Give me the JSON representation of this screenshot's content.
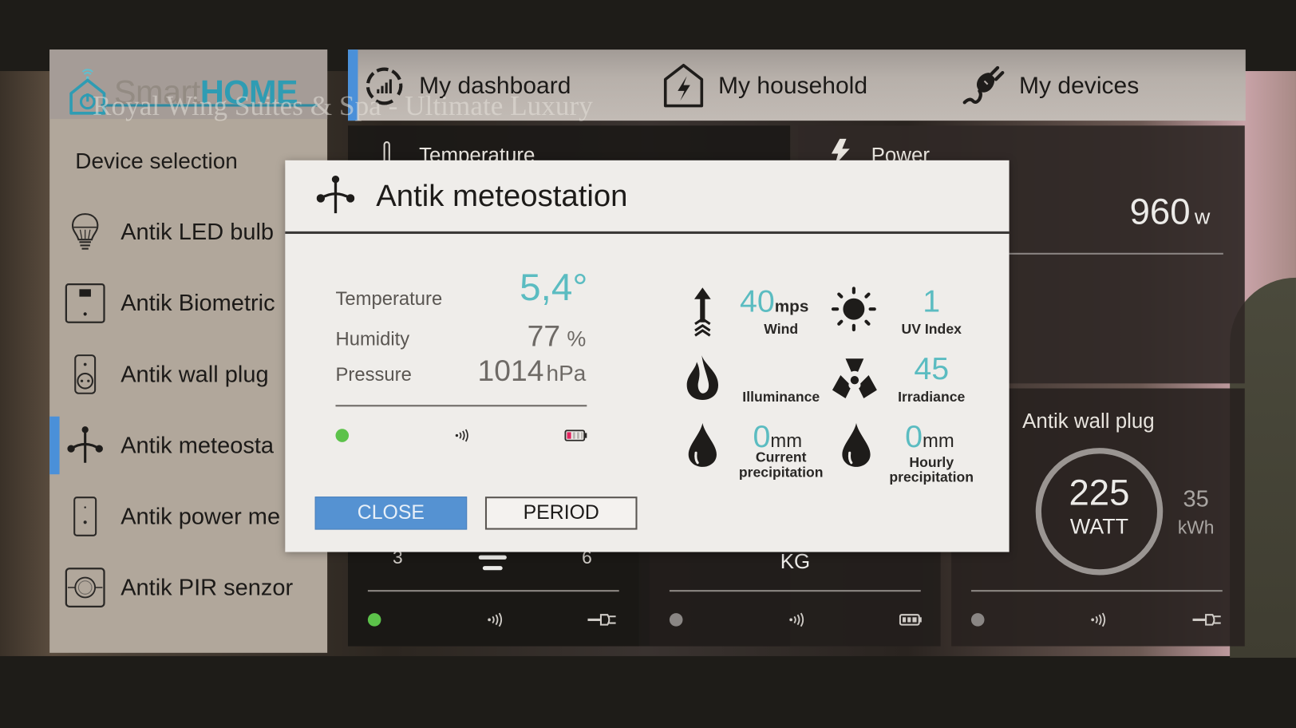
{
  "app": {
    "logo_smart": "Smart",
    "logo_home": "HOME",
    "overlay_caption": "Royal Wing Suites & Spa - Ultimate Luxury"
  },
  "nav": {
    "items": [
      {
        "label": "My dashboard",
        "icon": "dashboard-gauge-icon"
      },
      {
        "label": "My household",
        "icon": "house-bolt-icon"
      },
      {
        "label": "My devices",
        "icon": "plug-icon"
      }
    ]
  },
  "sidebar": {
    "title": "Device selection",
    "items": [
      {
        "label": "Antik LED bulb",
        "icon": "bulb-icon",
        "active": false
      },
      {
        "label": "Antik Biometric",
        "icon": "biometric-reader-icon",
        "active": false
      },
      {
        "label": "Antik wall plug",
        "icon": "wall-plug-icon",
        "active": false
      },
      {
        "label": "Antik meteosta",
        "icon": "meteostation-icon",
        "active": true
      },
      {
        "label": "Antik power me",
        "icon": "power-meter-icon",
        "active": false
      },
      {
        "label": "Antik PIR senzor",
        "icon": "pir-sensor-icon",
        "active": false
      }
    ]
  },
  "cards": {
    "temperature": {
      "title": "Temperature",
      "tick_left": "3",
      "tick_right": "6"
    },
    "power": {
      "title": "Power",
      "value": "960",
      "unit": "w"
    },
    "weight": {
      "unit": "KG"
    },
    "wall_plug": {
      "title": "Antik wall plug",
      "watt_value": "225",
      "watt_unit": "WATT",
      "kwh_value": "35",
      "kwh_unit": "kWh"
    }
  },
  "modal": {
    "title": "Antik meteostation",
    "readings": [
      {
        "label": "Temperature",
        "value": "5,4°",
        "unit": ""
      },
      {
        "label": "Humidity",
        "value": "77",
        "unit": "%"
      },
      {
        "label": "Pressure",
        "value": "1014",
        "unit": "hPa"
      }
    ],
    "status": {
      "online": true,
      "signal": "wireless-signal",
      "battery_level": "low"
    },
    "sensors": [
      {
        "label": "Wind",
        "value": "40",
        "unit": "mps",
        "icon": "wind-arrow-icon"
      },
      {
        "label": "UV Index",
        "value": "1",
        "unit": "",
        "icon": "sun-icon"
      },
      {
        "label": "Illuminance",
        "value": "",
        "unit": "",
        "icon": "flame-icon"
      },
      {
        "label": "Irradiance",
        "value": "45",
        "unit": "",
        "icon": "radiation-icon"
      },
      {
        "label_line1": "Current",
        "label_line2": "precipitation",
        "value": "0",
        "unit": "mm",
        "icon": "drop-icon"
      },
      {
        "label_line1": "Hourly",
        "label_line2": "precipitation",
        "value": "0",
        "unit": "mm",
        "icon": "drop-icon"
      }
    ],
    "close_label": "CLOSE",
    "period_label": "PERIOD"
  },
  "colors": {
    "accent_blue": "#4a90d9",
    "teal": "#5bbcc1",
    "online_green": "#5cc24a",
    "battery_low": "#e0245e"
  }
}
